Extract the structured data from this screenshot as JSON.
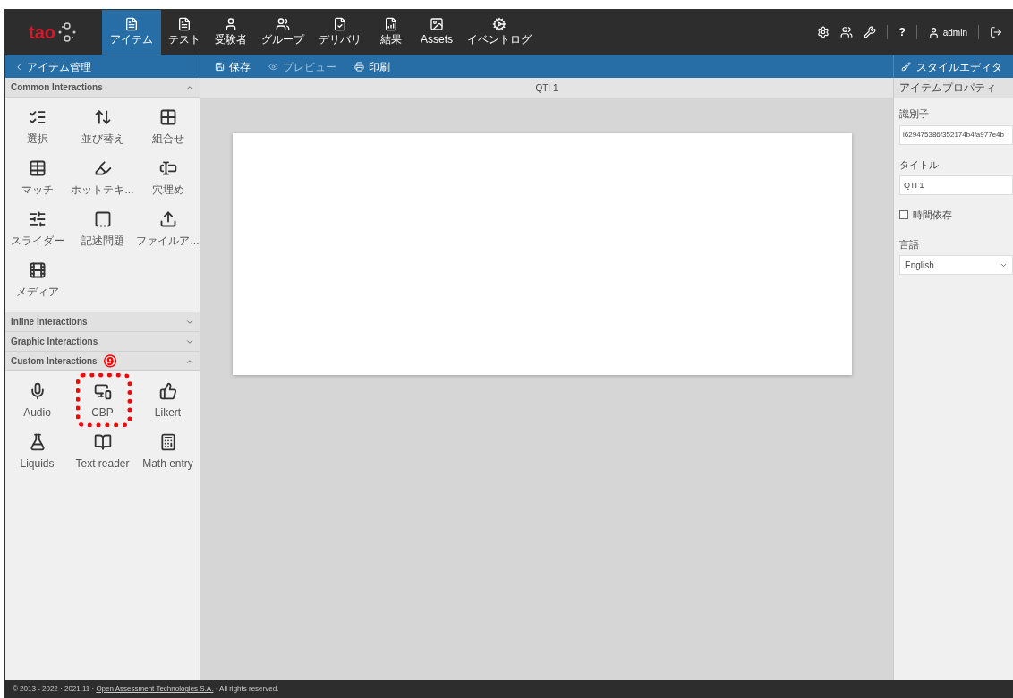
{
  "nav": {
    "logo": "tao",
    "items": [
      {
        "label": "アイテム",
        "selected": true
      },
      {
        "label": "テスト",
        "selected": false
      },
      {
        "label": "受験者",
        "selected": false
      },
      {
        "label": "グループ",
        "selected": false
      },
      {
        "label": "デリバリ",
        "selected": false
      },
      {
        "label": "結果",
        "selected": false
      },
      {
        "label": "Assets",
        "selected": false
      },
      {
        "label": "イベントログ",
        "selected": false
      }
    ],
    "help": "?",
    "user": "admin"
  },
  "toolbar": {
    "back": "アイテム管理",
    "actions": [
      {
        "label": "保存",
        "disabled": false
      },
      {
        "label": "プレビュー",
        "disabled": true
      },
      {
        "label": "印刷",
        "disabled": false
      }
    ],
    "style_editor": "スタイルエディタ"
  },
  "sections": [
    {
      "title": "Common Interactions",
      "expanded": true,
      "items": [
        {
          "label": "選択",
          "highlighted": false
        },
        {
          "label": "並び替え",
          "highlighted": false
        },
        {
          "label": "組合せ",
          "highlighted": false
        },
        {
          "label": "マッチ",
          "highlighted": false
        },
        {
          "label": "ホットテキ...",
          "highlighted": false
        },
        {
          "label": "穴埋め",
          "highlighted": false
        },
        {
          "label": "スライダー",
          "highlighted": false
        },
        {
          "label": "記述問題",
          "highlighted": false
        },
        {
          "label": "ファイルア...",
          "highlighted": false
        },
        {
          "label": "メディア",
          "highlighted": false
        }
      ]
    },
    {
      "title": "Inline Interactions",
      "expanded": false
    },
    {
      "title": "Graphic Interactions",
      "expanded": false
    },
    {
      "title": "Custom Interactions",
      "expanded": true,
      "annotation": "⑨",
      "items": [
        {
          "label": "Audio",
          "highlighted": false
        },
        {
          "label": "CBP",
          "highlighted": true
        },
        {
          "label": "Likert",
          "highlighted": false
        },
        {
          "label": "Liquids",
          "highlighted": false
        },
        {
          "label": "Text reader",
          "highlighted": false
        },
        {
          "label": "Math entry",
          "highlighted": false
        }
      ]
    }
  ],
  "canvas": {
    "title": "QTI 1"
  },
  "properties": {
    "title": "アイテムプロパティ",
    "identifier_label": "識別子",
    "identifier": "i629475386f352174b4fa977e4b",
    "title_label": "タイトル",
    "title_value": "QTI 1",
    "time_dependent": {
      "label": "時間依存",
      "checked": false
    },
    "language_label": "言語",
    "language": "English"
  },
  "footer": {
    "prefix": "© 2013 - 2022 · 2021.11 · ",
    "link": "Open Assessment Technologies S.A.",
    "suffix": " · All rights reserved."
  }
}
